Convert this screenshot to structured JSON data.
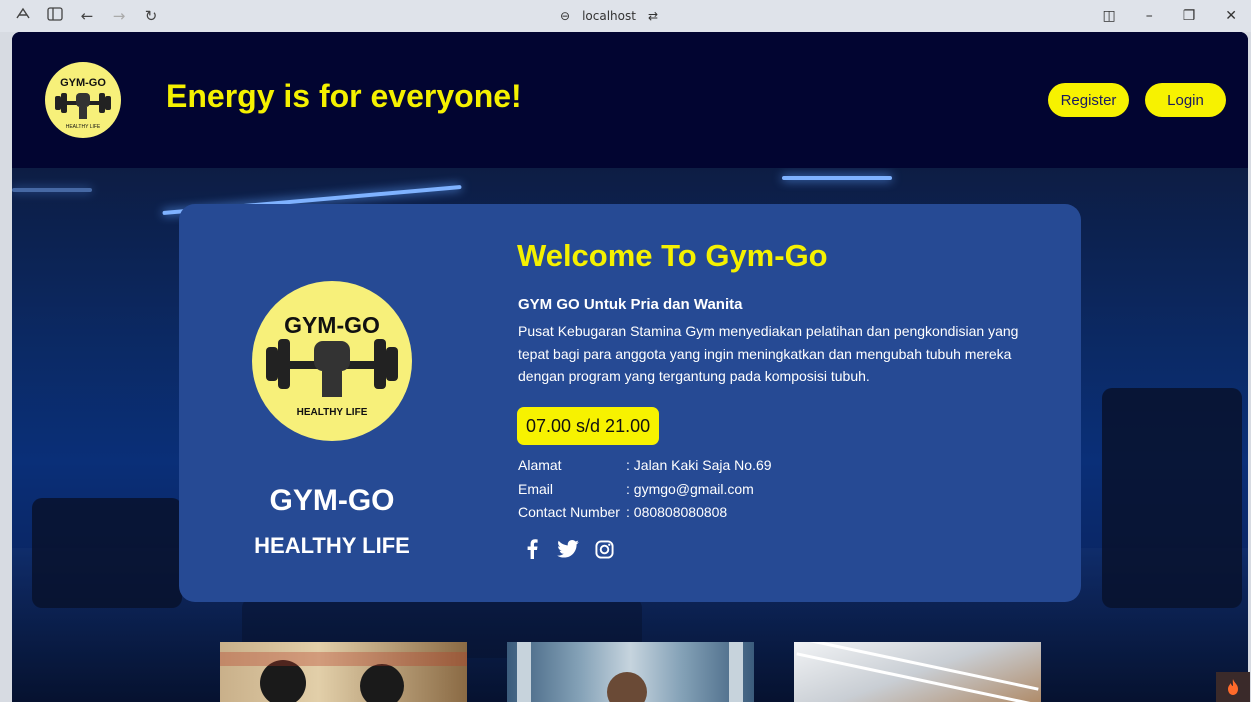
{
  "browser": {
    "url": "localhost"
  },
  "header": {
    "logo_alt": "GYM-GO HEALTHY LIFE",
    "tagline": "Energy is for everyone!",
    "register_label": "Register",
    "login_label": "Login"
  },
  "card": {
    "logo_top_text": "GYM-GO",
    "logo_bottom_text": "HEALTHY LIFE",
    "brand_title": "GYM-GO",
    "brand_subtitle": "HEALTHY LIFE",
    "welcome_title": "Welcome To Gym-Go",
    "subheading": "GYM GO Untuk Pria dan Wanita",
    "description": "Pusat Kebugaran Stamina Gym menyediakan pelatihan dan pengkondisian yang tepat bagi para anggota yang ingin meningkatkan dan mengubah tubuh mereka dengan program yang tergantung pada komposisi tubuh.",
    "hours": "07.00 s/d 21.00",
    "address_label": "Alamat",
    "address_value": ": Jalan Kaki Saja No.69",
    "email_label": "Email",
    "email_value": ": gymgo@gmail.com",
    "contact_label": "Contact Number",
    "contact_value": ": 080808080808",
    "social": [
      "facebook-icon",
      "twitter-icon",
      "instagram-icon"
    ]
  },
  "colors": {
    "header_bg": "#020531",
    "accent_yellow": "#f7f200",
    "card_bg": "#264a94",
    "logo_bg": "#f7f07a"
  }
}
